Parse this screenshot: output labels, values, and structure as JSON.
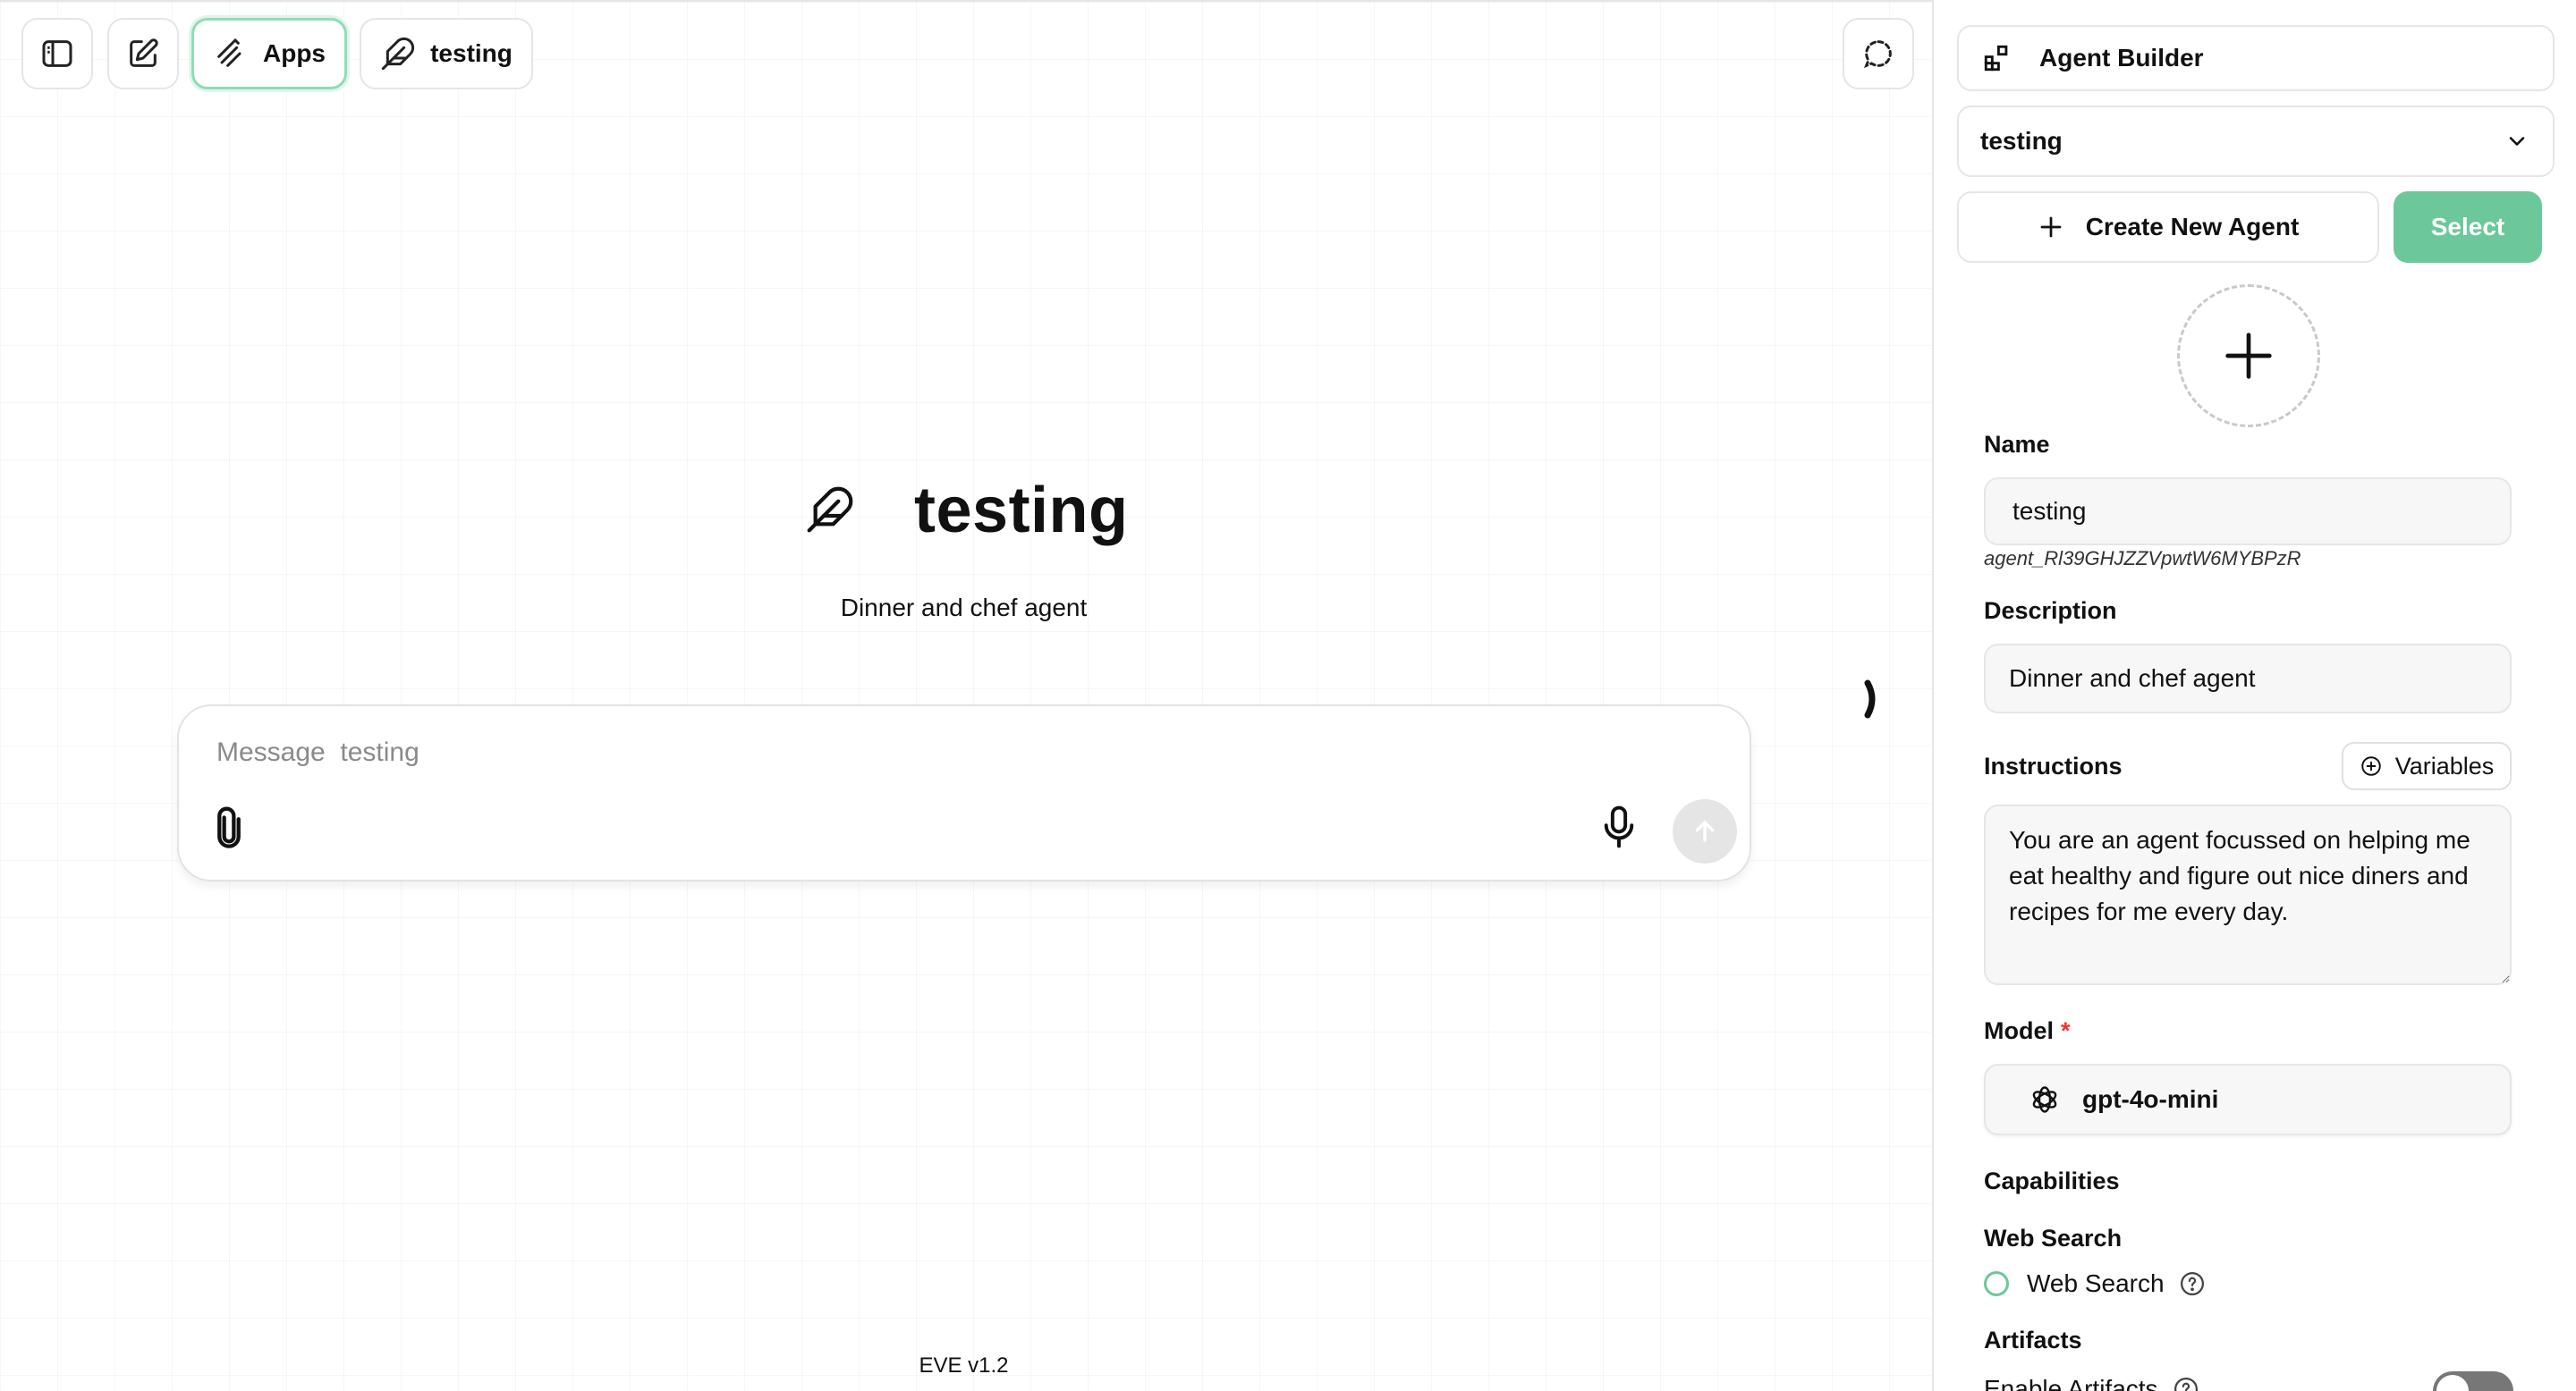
{
  "toolbar": {
    "apps_label": "Apps",
    "agent_label": "testing"
  },
  "hero": {
    "title": "testing",
    "description": "Dinner and chef agent"
  },
  "composer": {
    "placeholder": "Message  testing"
  },
  "footer": {
    "version": "EVE v1.2"
  },
  "sidebar": {
    "title": "Agent Builder",
    "agent_select_value": "testing",
    "create_agent_label": "Create New Agent",
    "select_label": "Select",
    "name_label": "Name",
    "name_value": "testing",
    "agent_id": "agent_Rl39GHJZZVpwtW6MYBPzR",
    "description_label": "Description",
    "description_value": "Dinner and chef agent",
    "instructions_label": "Instructions",
    "variables_label": "Variables",
    "instructions_value": "You are an agent focussed on helping me eat healthy and figure out nice diners and recipes for me every day.",
    "model_label": "Model",
    "model_required_marker": "*",
    "model_value": "gpt-4o-mini",
    "capabilities_label": "Capabilities",
    "web_search_section": "Web Search",
    "web_search_option": "Web Search",
    "web_search_checked": false,
    "artifacts_section": "Artifacts",
    "artifacts_option": "Enable Artifacts",
    "artifacts_enabled": false
  },
  "colors": {
    "accent_green": "#6cc79a",
    "apps_border": "#8fdcb8",
    "required": "#e33"
  },
  "icons": {
    "sidebar_toggle": "sidebar-toggle-icon",
    "new_chat": "edit-icon",
    "apps": "apps-icon",
    "agent": "feather-icon",
    "temporary_chat": "dashed-chat-icon",
    "builder": "blocks-icon",
    "chevron": "chevron-down-icon",
    "plus": "plus-icon",
    "attach": "paperclip-icon",
    "mic": "mic-icon",
    "send": "arrow-up-icon",
    "model": "openai-icon",
    "help": "help-icon"
  }
}
